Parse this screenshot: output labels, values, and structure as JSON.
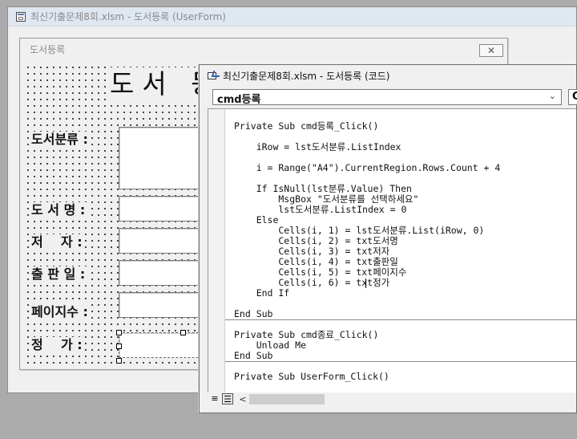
{
  "userform_window": {
    "title": "최신기출문제8회.xlsm - 도서등록 (UserForm)"
  },
  "form": {
    "caption": "도서등록",
    "close_glyph": "✕",
    "heading": "도서 등",
    "labels": {
      "category": "도서분류 :",
      "title": "도 서 명 :",
      "author": "저    자 :",
      "publisher": "출 판 일 :",
      "pages": "페이지수 :",
      "price": "정    가 :"
    }
  },
  "code_window": {
    "title": "최신기출문제8회.xlsm - 도서등록 (코드)",
    "object_combo": "cmd등록",
    "object_combo_arrow": "⌄",
    "procedure_combo": "C",
    "lines": [
      "Private Sub cmd등록_Click()",
      "",
      "    iRow = lst도서분류.ListIndex",
      "",
      "    i = Range(\"A4\").CurrentRegion.Rows.Count + 4",
      "",
      "    If IsNull(lst분류.Value) Then",
      "        MsgBox \"도서분류를 선택하세요\"",
      "        lst도서분류.ListIndex = 0",
      "    Else",
      "        Cells(i, 1) = lst도서분류.List(iRow, 0)",
      "        Cells(i, 2) = txt도서명",
      "        Cells(i, 3) = txt저자",
      "        Cells(i, 4) = txt출판일",
      "        Cells(i, 5) = txt페이지수",
      "        Cells(i, 6) = txt정가",
      "    End If",
      "",
      "End Sub",
      "",
      "Private Sub cmd종료_Click()",
      "    Unload Me",
      "End Sub",
      "",
      "Private Sub UserForm_Click()"
    ],
    "scroll_left": "<",
    "view_procedure_icon": "≡",
    "view_module_icon": "☰"
  }
}
